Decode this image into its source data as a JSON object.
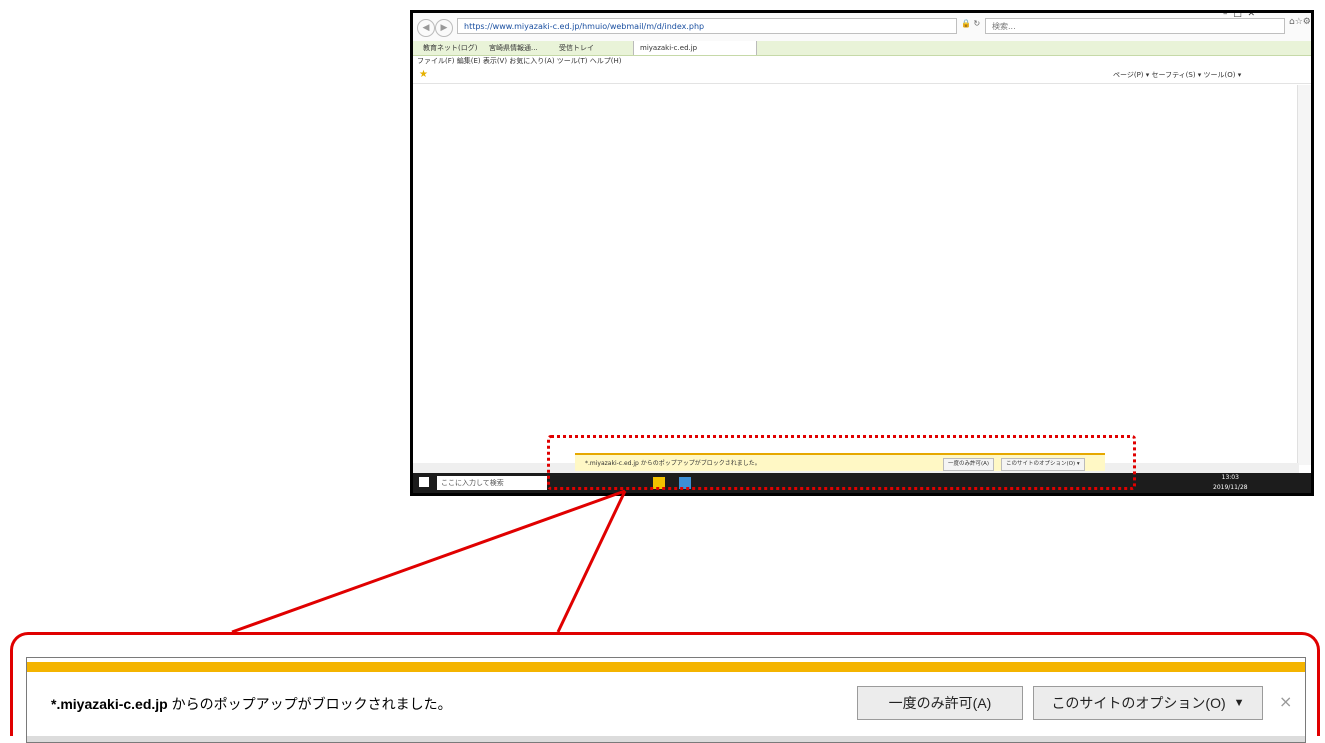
{
  "browser": {
    "url": "https://www.miyazaki-c.ed.jp/hmuio/webmail/m/d/index.php",
    "search_placeholder": "検索...",
    "tabs": [
      "教育ネット(ログ)",
      "宮崎県情報通...",
      "受信トレイ",
      "miyazaki-c.ed.jp"
    ],
    "menu": "ファイル(F)  編集(E)  表示(V)  お気に入り(A)  ツール(T)  ヘルプ(H)",
    "command_bar": "ページ(P) ▾  セーフティ(S) ▾  ツール(O) ▾",
    "taskbar_search": "ここに入力して検索",
    "clock_time": "13:03",
    "clock_date": "2019/11/28"
  },
  "mini_popup": {
    "message": "*.miyazaki-c.ed.jp からのポップアップがブロックされました。",
    "allow_once": "一度のみ許可(A)",
    "options": "このサイトのオプション(O) ▾"
  },
  "popup_bar": {
    "domain": "*.miyazaki-c.ed.jp",
    "message": "からのポップアップがブロックされました。",
    "allow_once_label": "一度のみ許可(A)",
    "options_label": "このサイトのオプション(O)",
    "options_arrow": "▼",
    "close_label": "×"
  },
  "colors": {
    "highlight": "#e00000",
    "notification_accent": "#f4b400"
  }
}
